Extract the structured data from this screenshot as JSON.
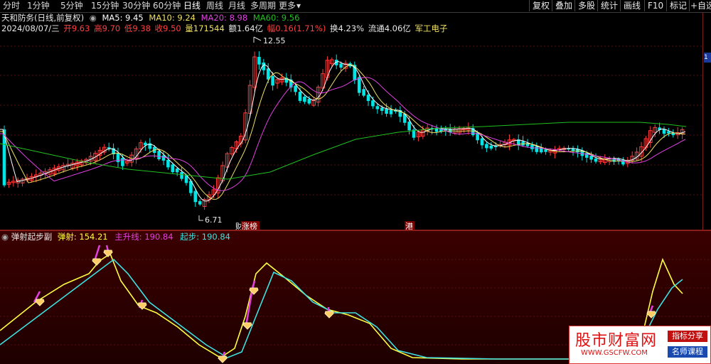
{
  "toolbar": {
    "period_tabs": [
      "分时",
      "1分钟",
      "5分钟",
      "15分钟",
      "30分钟",
      "60分钟",
      "日线",
      "周线",
      "月线",
      "多周期",
      "更多"
    ],
    "active_tab": "日线",
    "right_buttons": [
      "复权",
      "叠加",
      "多股",
      "统计",
      "画线",
      "F10",
      "标记",
      "+自选"
    ],
    "more_arrow": "▾"
  },
  "info": {
    "stock_name": "天和防务(日线,前复权)",
    "ma5": "MA5: 9.45",
    "ma10": "MA10: 9.24",
    "ma20": "MA20: 8.98",
    "ma60": "MA60: 9.56",
    "date": "2024/08/07/三",
    "open": "开9.63",
    "high": "高9.70",
    "low": "低9.38",
    "close": "收9.50",
    "volume": "量171544",
    "amount": "额1.64亿",
    "change": "幅0.16(1.71%)",
    "turnover": "换4.23%",
    "float_cap": "流通4.06亿",
    "sector": "军工电子"
  },
  "chart_markers": {
    "high_price": "12.55",
    "low_price": "6.71",
    "event1": "财",
    "event2": "涨榜",
    "event3": "港"
  },
  "indicator": {
    "name": "弹射起步副",
    "tanshe": "弹射: 154.21",
    "zhusheng": "主升线: 190.84",
    "qibu": "起步: 190.84"
  },
  "watermark": {
    "title": "股市财富网",
    "url": "WWW.GSCFW.COM",
    "tag1": "指标分享",
    "tag2": "名师课程"
  },
  "colors": {
    "up": "#ff3b3b",
    "down": "#00e5e5",
    "ma5": "#ffffff",
    "ma10": "#f0e060",
    "ma20": "#e040e0",
    "ma60": "#20c020",
    "tanshe": "#ffff40",
    "zhusheng": "#e040e0",
    "qibu": "#40e0e0"
  }
}
